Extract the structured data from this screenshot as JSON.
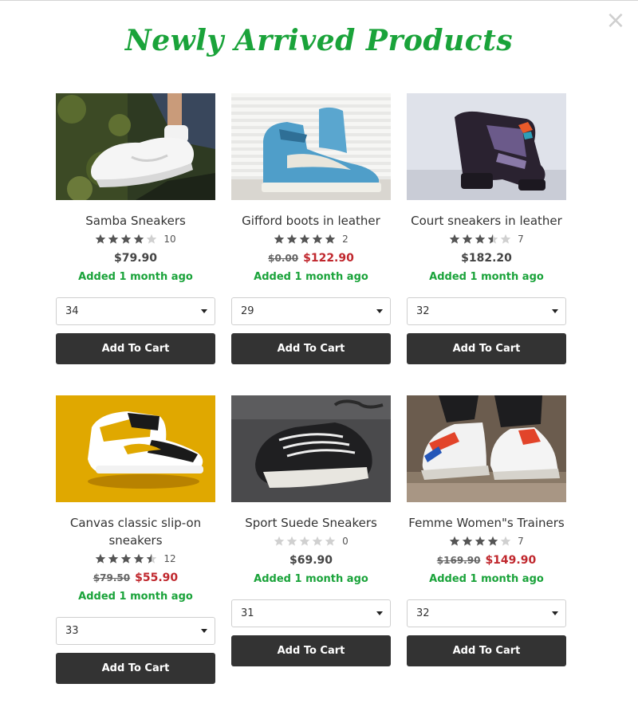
{
  "title": "Newly Arrived Products",
  "close_label": "×",
  "add_to_cart_label": "Add To Cart",
  "products": [
    {
      "name": "Samba Sneakers",
      "rating": 4,
      "reviews": "10",
      "price": "$79.90",
      "old_price": "",
      "sale_price": "",
      "added": "Added 1 month ago",
      "size": "34",
      "image": "white-sneaker-photo"
    },
    {
      "name": "Gifford boots in leather",
      "rating": 5,
      "reviews": "2",
      "price": "",
      "old_price": "$0.00",
      "sale_price": "$122.90",
      "added": "Added 1 month ago",
      "size": "29",
      "image": "blue-suede-hightop-photo"
    },
    {
      "name": "Court sneakers in leather",
      "rating": 3.5,
      "reviews": "7",
      "price": "$182.20",
      "old_price": "",
      "sale_price": "",
      "added": "Added 1 month ago",
      "size": "32",
      "image": "black-purple-hightop-photo"
    },
    {
      "name": "Canvas classic slip-on sneakers",
      "rating": 4.5,
      "reviews": "12",
      "price": "",
      "old_price": "$79.50",
      "sale_price": "$55.90",
      "added": "Added 1 month ago",
      "size": "33",
      "image": "yellow-hightop-photo"
    },
    {
      "name": "Sport Suede Sneakers",
      "rating": 0,
      "reviews": "0",
      "price": "$69.90",
      "old_price": "",
      "sale_price": "",
      "added": "Added 1 month ago",
      "size": "31",
      "image": "black-canvas-sneaker-photo"
    },
    {
      "name": "Femme Women\"s Trainers",
      "rating": 4,
      "reviews": "7",
      "price": "",
      "old_price": "$169.90",
      "sale_price": "$149.90",
      "added": "Added 1 month ago",
      "size": "32",
      "image": "ellesse-trainer-photo"
    }
  ],
  "colors": {
    "accent_green": "#1aa33a",
    "sale_red": "#c0272d",
    "button_dark": "#333333",
    "star_filled": "#555555",
    "star_empty": "#d0d0d0"
  }
}
